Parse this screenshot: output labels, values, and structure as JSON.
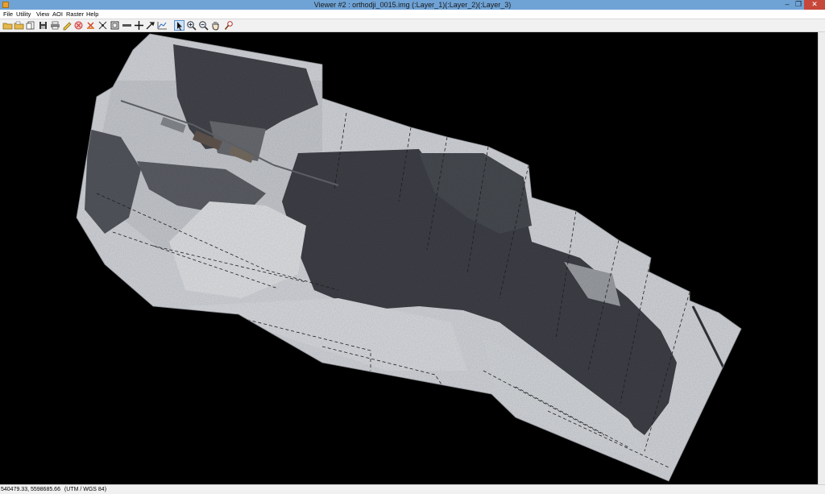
{
  "window": {
    "title": "Viewer #2 : orthodji_0015.img (:Layer_1)(:Layer_2)(:Layer_3)"
  },
  "menu": {
    "file": "File",
    "utility": "Utility",
    "view": "View",
    "aoi": "AOI",
    "raster": "Raster",
    "help": "Help"
  },
  "toolbar_icons": [
    "open-folder-icon",
    "open-folder-icon",
    "new-window-icon",
    "save-icon",
    "print-icon",
    "edit-icon",
    "close-layer-icon",
    "clear-icon",
    "fit-to-frame-icon",
    "full-extent-icon",
    "measure-icon",
    "crosshair-icon",
    "edit-tool-icon",
    "profile-icon",
    "select-pointer-icon",
    "zoom-in-icon",
    "zoom-out-icon",
    "pan-hand-icon",
    "inquire-icon"
  ],
  "status": {
    "coordinates": "540479.33, 5598685.66",
    "projection": "(UTM / WGS 84)"
  },
  "colors": {
    "titlebar": "#6fa3d6",
    "close": "#c7473a",
    "canvas": "#000000"
  }
}
